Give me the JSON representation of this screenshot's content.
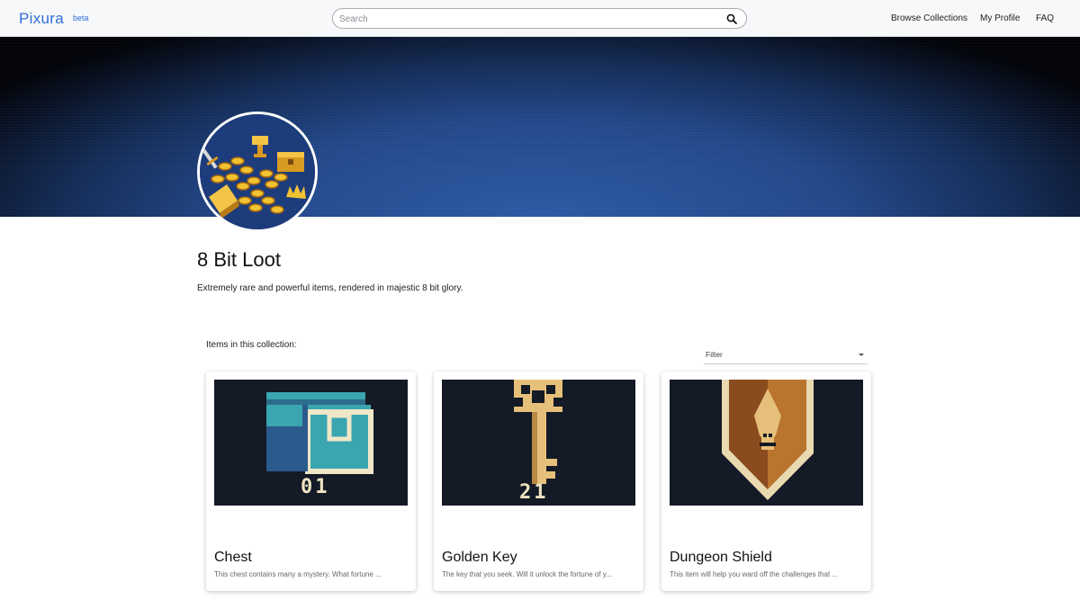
{
  "header": {
    "logo": "Pixura",
    "logo_badge": "beta",
    "search_placeholder": "Search",
    "nav": [
      "Browse Collections",
      "My Profile",
      "FAQ"
    ]
  },
  "collection": {
    "title": "8 Bit Loot",
    "description": "Extremely rare and powerful items, rendered in majestic 8 bit glory."
  },
  "items_label": "Items in this collection:",
  "filter_label": "Filter",
  "items": [
    {
      "name": "Chest",
      "description": "This chest contains many a mystery. What fortune ...",
      "number": "01",
      "icon": "chest-icon"
    },
    {
      "name": "Golden Key",
      "description": "The key that you seek. Will it unlock the fortune of y...",
      "number": "21",
      "icon": "key-icon"
    },
    {
      "name": "Dungeon Shield",
      "description": "This item will help you ward off the challenges that ...",
      "number": "",
      "icon": "shield-icon"
    }
  ],
  "colors": {
    "brand": "#2f6fd6",
    "banner": "#2c5aa3",
    "card_image_bg": "#141a26"
  }
}
